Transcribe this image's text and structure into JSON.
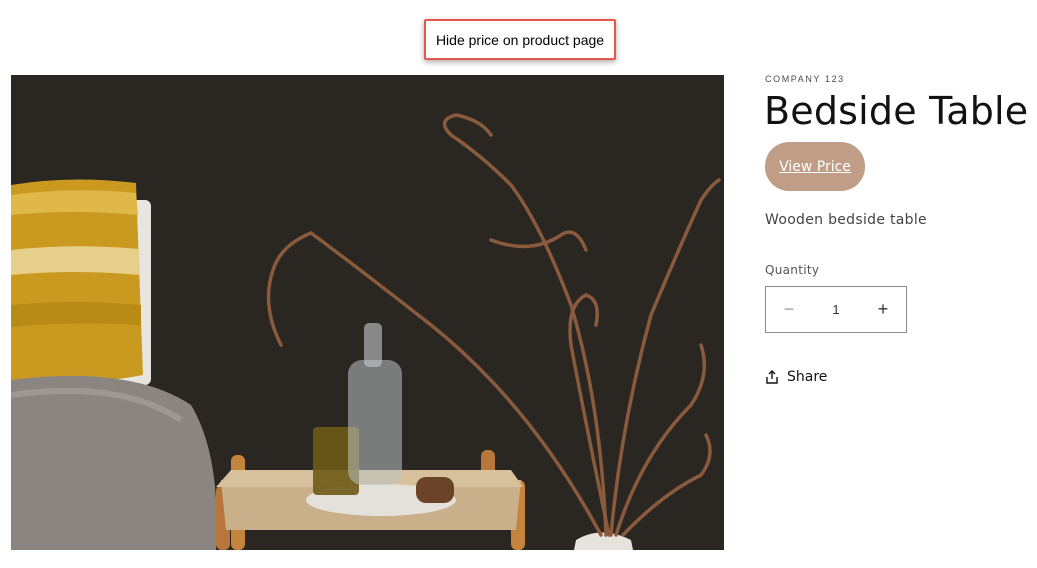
{
  "callout": {
    "text": "Hide price on product page"
  },
  "product": {
    "vendor": "COMPANY 123",
    "title": "Bedside Table",
    "view_price_label": "View Price",
    "description": "Wooden bedside table",
    "quantity_label": "Quantity",
    "quantity_value": "1",
    "minus_symbol": "−",
    "plus_symbol": "+",
    "share_label": "Share"
  },
  "colors": {
    "accent_button": "#c09d86",
    "callout_border": "#e4574d",
    "image_background": "#2a2723"
  },
  "icons": {
    "share": "share-icon",
    "minus": "minus-icon",
    "plus": "plus-icon"
  }
}
